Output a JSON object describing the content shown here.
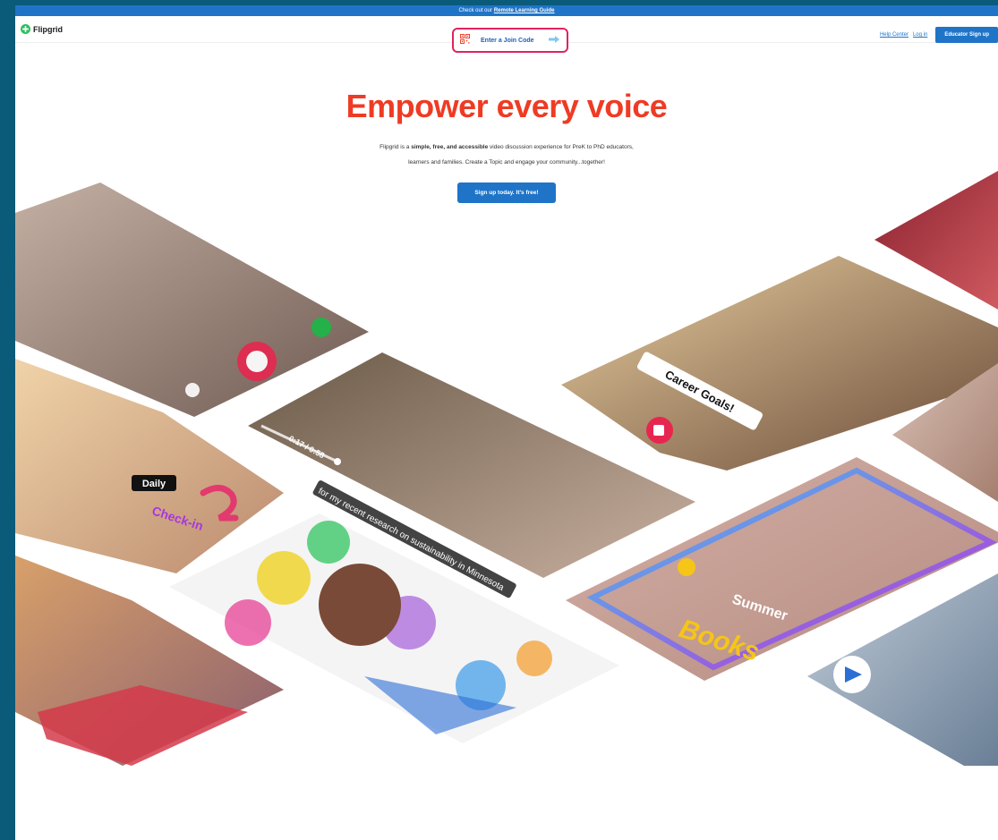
{
  "banner": {
    "prefix": "Check out our",
    "link": "Remote Learning Guide"
  },
  "header": {
    "brand": "Flipgrid",
    "join_code_label": "Enter a Join Code",
    "help_center": "Help Center",
    "login": "Log in",
    "educator_signup": "Educator Sign up"
  },
  "hero": {
    "title": "Empower every voice",
    "desc_part1": "Flipgrid is a ",
    "desc_bold": "simple, free, and accessible",
    "desc_part2": " video discussion experience for PreK to PhD educators,",
    "desc_line2": "learners and families. Create a Topic and engage your community...together!",
    "cta": "Sign up today. It's free!"
  },
  "collage": {
    "sticker_career": "Career Goals!",
    "sticker_daily": "Daily",
    "sticker_checkin": "Check-in",
    "sticker_summer": "Summer",
    "sticker_books": "Books",
    "video_time": "0:17 / 0:58",
    "caption": "for my recent research on sustainability in Minnesota"
  },
  "colors": {
    "brand_blue": "#1f74c8",
    "title_red": "#ef3b24",
    "highlight_pink": "#e0245e",
    "frame_teal": "#0a5a7a"
  }
}
